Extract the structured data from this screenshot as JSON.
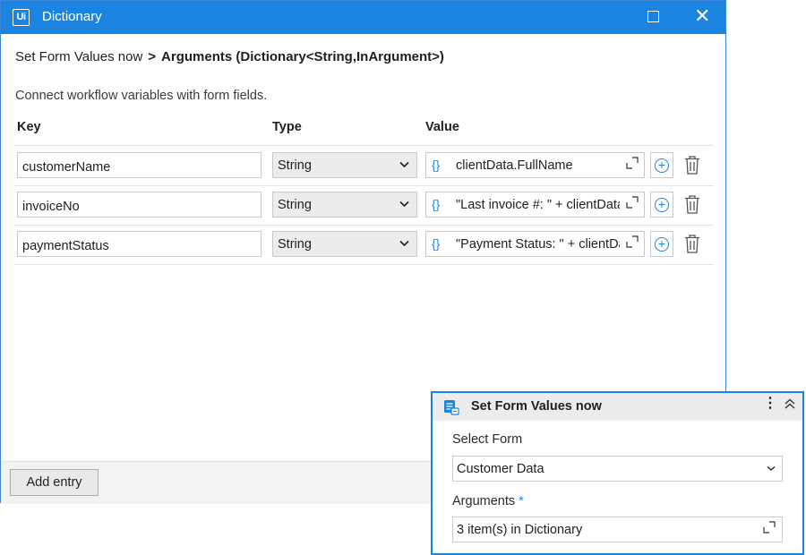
{
  "window": {
    "logo": "Ui",
    "title": "Dictionary"
  },
  "breadcrumb": {
    "parent": "Set Form Values now",
    "separator": ">",
    "current": "Arguments (Dictionary<String,InArgument>)"
  },
  "description": "Connect workflow variables with form fields.",
  "columns": {
    "key": "Key",
    "type": "Type",
    "value": "Value"
  },
  "entries": [
    {
      "key": "customerName",
      "type": "String",
      "value": "clientData.FullName"
    },
    {
      "key": "invoiceNo",
      "type": "String",
      "value": "\"Last invoice #: \" + clientData"
    },
    {
      "key": "paymentStatus",
      "type": "String",
      "value": "\"Payment Status: \" + clientData"
    }
  ],
  "icons": {
    "brace": "{}",
    "expand": "expand-icon",
    "add": "+",
    "trash": "trash-icon",
    "chevron": "chevron-down-icon"
  },
  "footer": {
    "add_entry_label": "Add entry"
  },
  "activity_card": {
    "title": "Set Form Values now",
    "select_form_label": "Select Form",
    "select_form_value": "Customer Data",
    "arguments_label": "Arguments",
    "arguments_required_mark": "*",
    "arguments_value": "3 item(s) in Dictionary"
  },
  "colors": {
    "accent": "#1b84e0",
    "header_bg": "#ececec"
  }
}
